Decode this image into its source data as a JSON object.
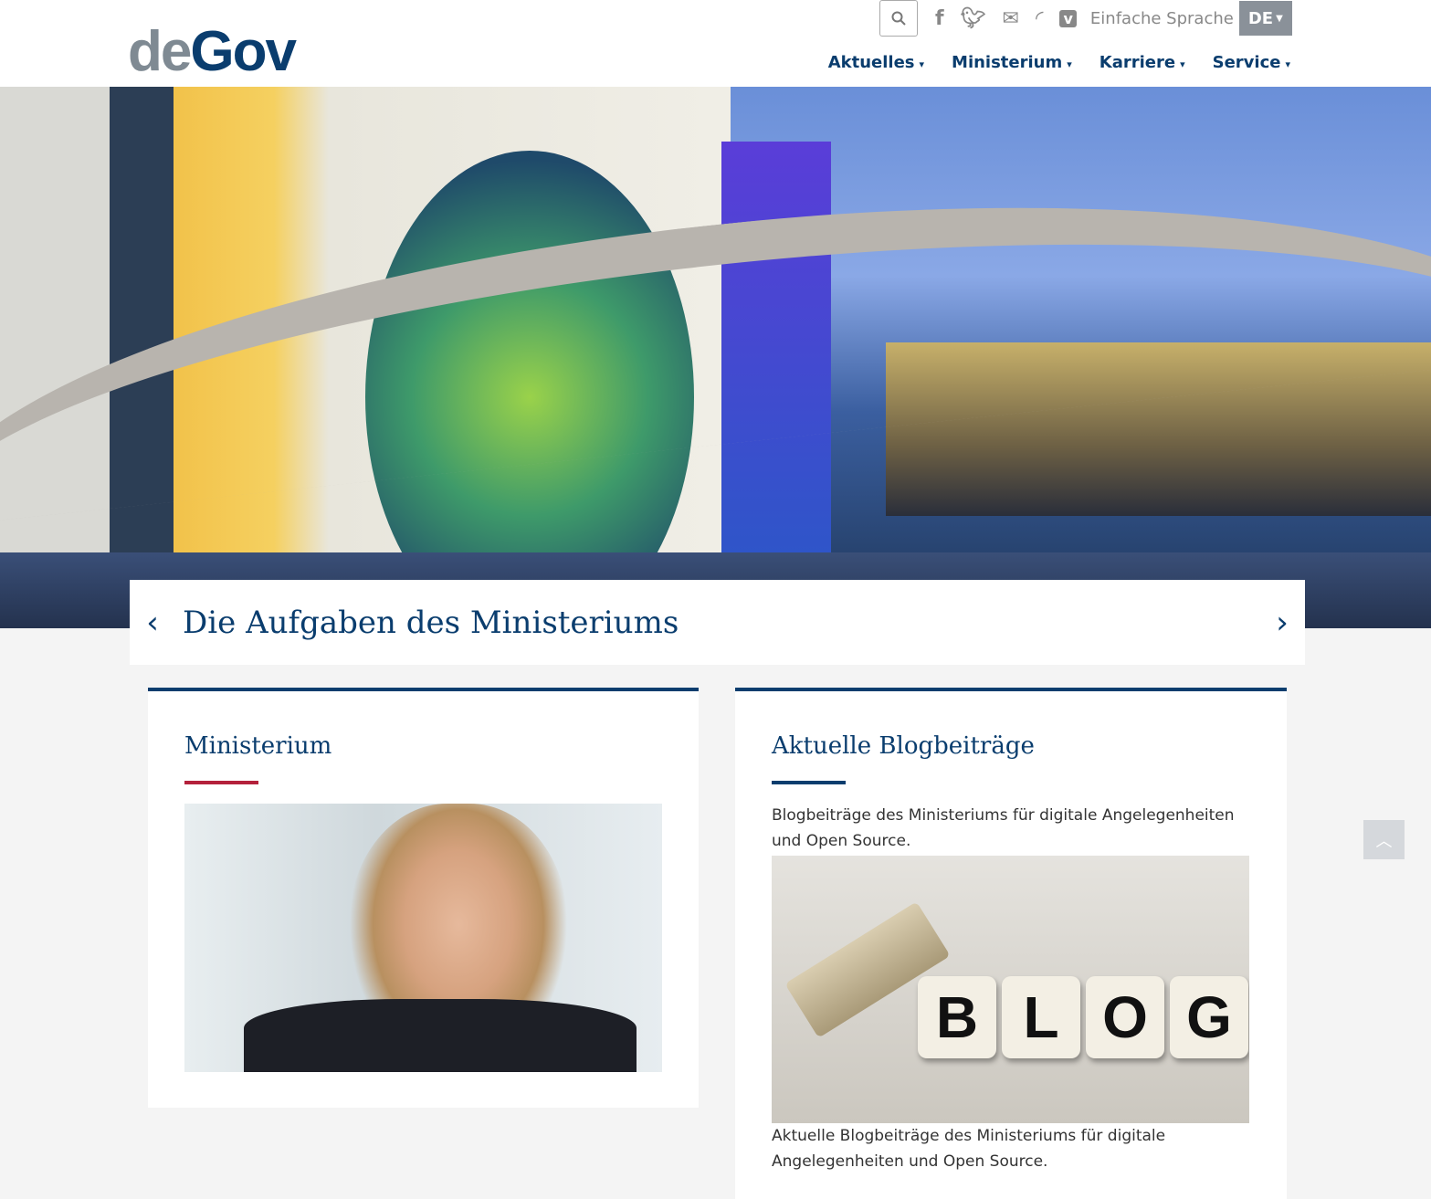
{
  "header": {
    "logo_part1": "de",
    "logo_part2": "Gov",
    "topbar": {
      "search_icon": "search-icon",
      "social_icons": [
        "facebook-icon",
        "twitter-icon",
        "mail-icon",
        "rss-icon",
        "vimeo-icon"
      ],
      "easy_language": "Einfache Sprache",
      "language": "DE"
    },
    "nav": [
      {
        "label": "Aktuelles"
      },
      {
        "label": "Ministerium"
      },
      {
        "label": "Karriere"
      },
      {
        "label": "Service"
      }
    ]
  },
  "hero": {
    "caption": "Die Aufgaben des Ministeriums",
    "prev": "‹",
    "next": "›"
  },
  "cards": {
    "ministerium": {
      "title": "Ministerium",
      "accent": "#b4213b"
    },
    "blog": {
      "title": "Aktuelle Blogbeiträge",
      "accent": "#0a3d6e",
      "text": "Blogbeiträge des Ministeriums für digitale Angelegenheiten und Open Source.",
      "image_letters": [
        "B",
        "L",
        "O",
        "G"
      ],
      "caption": "Aktuelle Blogbeiträge des Ministeriums für digitale Angelegenheiten und Open Source."
    }
  },
  "colors": {
    "primary": "#0a3d6e",
    "grey": "#8a9199"
  }
}
